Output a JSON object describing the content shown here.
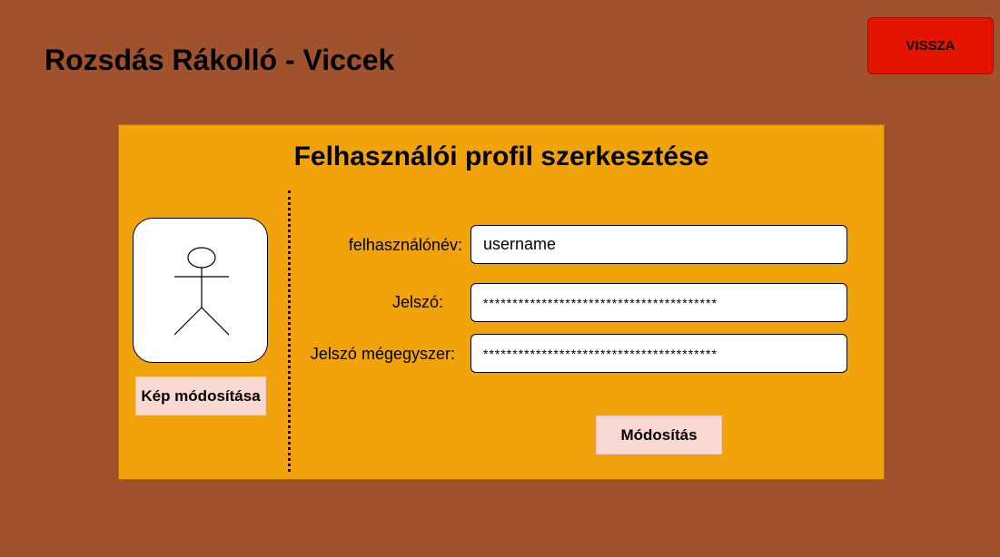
{
  "header": {
    "title": "Rozsdás Rákolló - Viccek",
    "back_label": "VISSZA"
  },
  "colors": {
    "page_background": "#a0522d",
    "panel_background": "#f0a30a",
    "back_button": "#e51400",
    "secondary_button": "#fad9d5"
  },
  "profile": {
    "title": "Felhasználói profil szerkesztése",
    "avatar_icon": "stick-figure-icon",
    "change_image_label": "Kép módosítása",
    "fields": {
      "username": {
        "label": "felhasználónév:",
        "value": "username"
      },
      "password": {
        "label": "Jelszó:",
        "value": "****************************************"
      },
      "password_again": {
        "label": "Jelszó mégegyszer:",
        "value": "****************************************"
      }
    },
    "submit_label": "Módosítás"
  }
}
